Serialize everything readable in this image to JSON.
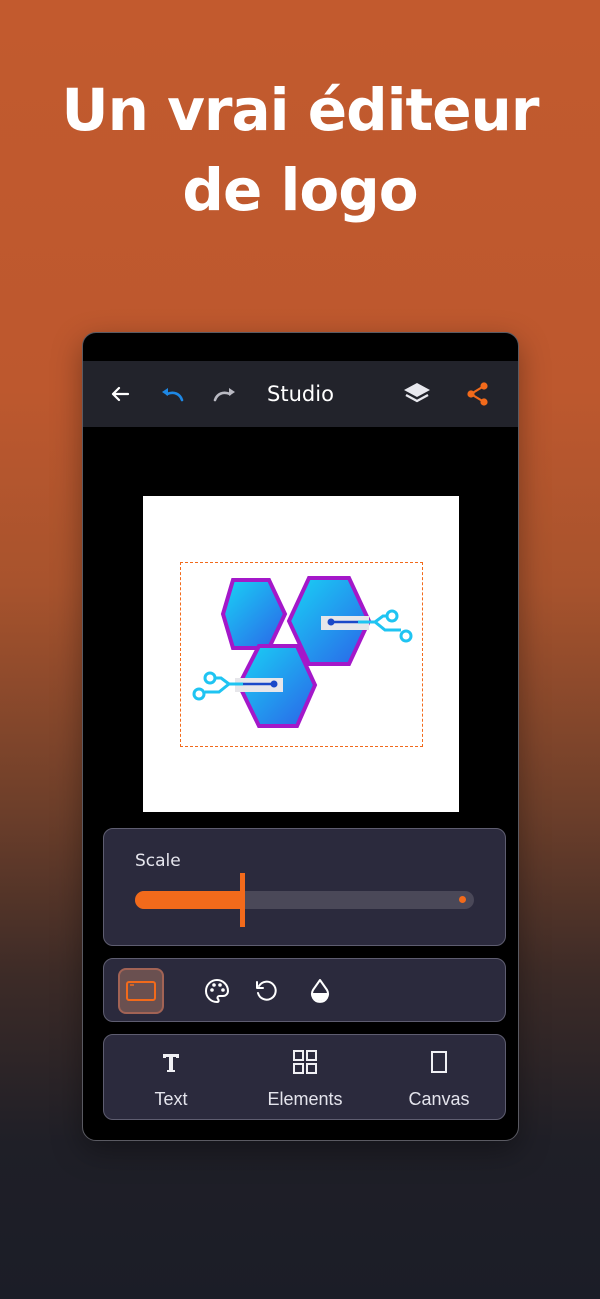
{
  "headline": {
    "line1": "Un vrai éditeur",
    "line2": "de logo"
  },
  "toolbar": {
    "title": "Studio",
    "icons": [
      "back-arrow-icon",
      "undo-icon",
      "redo-icon",
      "layers-icon",
      "share-icon"
    ]
  },
  "scale": {
    "label": "Scale",
    "value_fraction": 0.31
  },
  "tools": [
    "frame-icon",
    "palette-icon",
    "rotate-icon",
    "opacity-icon"
  ],
  "nav": {
    "items": [
      {
        "label": "Text",
        "icon": "text-icon"
      },
      {
        "label": "Elements",
        "icon": "grid-icon"
      },
      {
        "label": "Canvas",
        "icon": "canvas-icon"
      }
    ]
  },
  "colors": {
    "accent": "#f26a1b",
    "undo_active": "#1e88e5",
    "panel_bg": "#2b2a3d",
    "topbar_bg": "#22232b"
  }
}
